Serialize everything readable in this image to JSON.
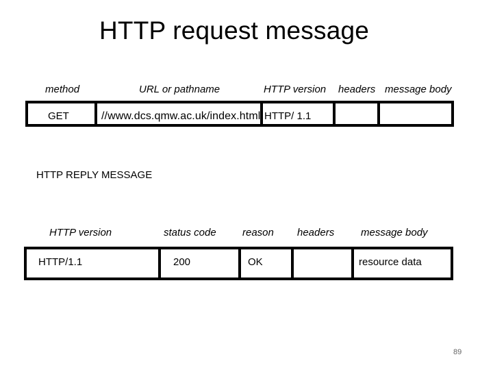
{
  "slide": {
    "title": "HTTP request message",
    "page_number": "89"
  },
  "request": {
    "labels": {
      "method": "method",
      "url": "URL or pathname",
      "version": "HTTP version",
      "headers": "headers",
      "body": "message body"
    },
    "cells": {
      "method": "GET",
      "url": "//www.dcs.qmw.ac.uk/index.html",
      "version": "HTTP/ 1.1",
      "headers": "",
      "body": ""
    }
  },
  "reply": {
    "section_title": "HTTP REPLY MESSAGE",
    "labels": {
      "version": "HTTP version",
      "status": "status code",
      "reason": "reason",
      "headers": "headers",
      "body": "message body"
    },
    "cells": {
      "version": "HTTP/1.1",
      "status": "200",
      "reason": "OK",
      "headers": "",
      "body": "resource data"
    }
  }
}
